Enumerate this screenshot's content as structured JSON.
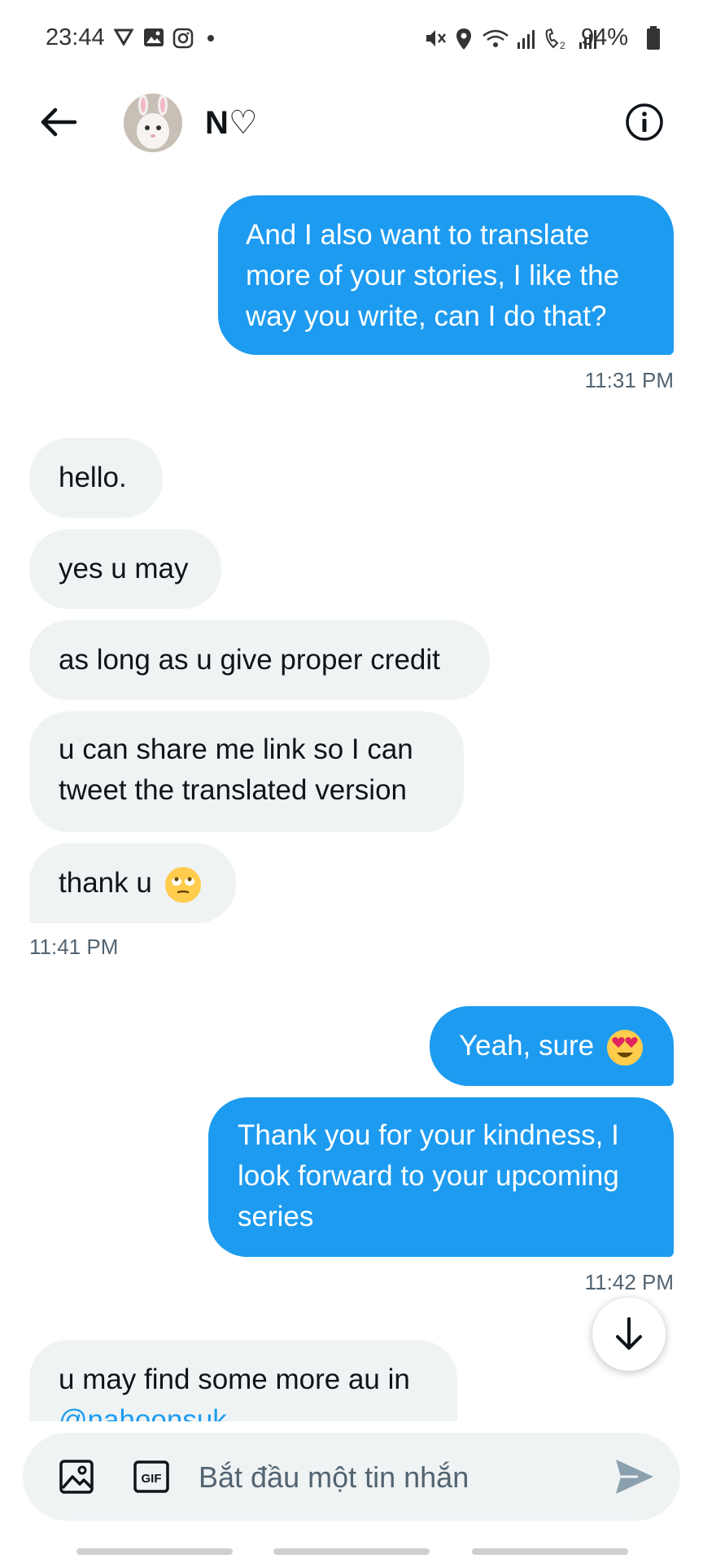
{
  "status_bar": {
    "time": "23:44",
    "battery": "94%",
    "icons_left": [
      "vpn-icon",
      "gallery-icon",
      "instagram-icon",
      "dot-icon"
    ],
    "icons_right": [
      "mute-icon",
      "location-icon",
      "wifi-icon",
      "signal-icon",
      "volte-icon",
      "signal-icon",
      "battery-icon"
    ]
  },
  "header": {
    "contact_name": "N♡"
  },
  "messages": [
    {
      "side": "sent",
      "text": "And I also want to translate more of your stories, I like the way you write, can I do that?"
    },
    {
      "side": "sent_time",
      "text": "11:31 PM"
    },
    {
      "side": "recv",
      "text": "hello."
    },
    {
      "side": "recv",
      "text": "yes u may"
    },
    {
      "side": "recv",
      "text": "as long as u give proper credit"
    },
    {
      "side": "recv",
      "text": "u can share me link so I can tweet the translated version"
    },
    {
      "side": "recv",
      "text": "thank u"
    },
    {
      "side": "recv_time",
      "text": "11:41 PM"
    },
    {
      "side": "sent",
      "text": "Yeah, sure"
    },
    {
      "side": "sent",
      "text": "Thank you for your kindness, I look forward to your upcoming series"
    },
    {
      "side": "sent_time",
      "text": "11:42 PM"
    },
    {
      "side": "recv",
      "text": "u may find some more au in"
    },
    {
      "side": "recv_link",
      "text": "@nahoonsuk"
    }
  ],
  "composer": {
    "placeholder": "Bắt đầu một tin nhắn",
    "gif_label": "GIF"
  },
  "colors": {
    "sent_bubble": "#1d9bf0",
    "recv_bubble": "#eff3f4",
    "timestamp": "#536471",
    "link": "#1d9bf0"
  }
}
